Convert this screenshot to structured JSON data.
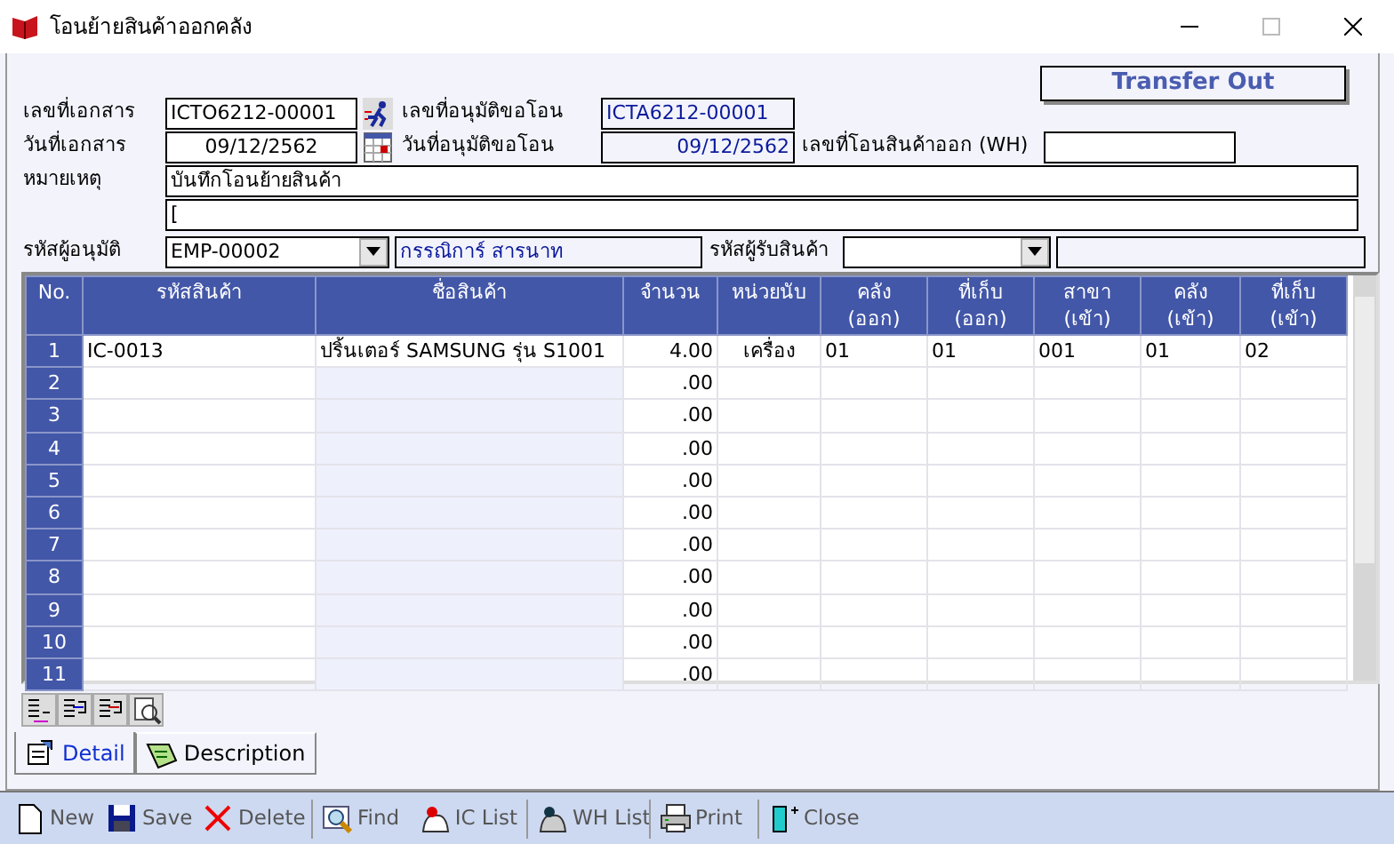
{
  "window": {
    "title": "โอนย้ายสินค้าออกคลัง"
  },
  "mode_badge": "Transfer Out",
  "header": {
    "doc_no": {
      "label": "เลขที่เอกสาร",
      "value": "ICTO6212-00001"
    },
    "approve_no": {
      "label": "เลขที่อนุมัติขอโอน",
      "value": "ICTA6212-00001"
    },
    "doc_date": {
      "label": "วันที่เอกสาร",
      "value": "09/12/2562"
    },
    "approve_date": {
      "label": "วันที่อนุมัติขอโอน",
      "value": "09/12/2562"
    },
    "wh_transfer_no": {
      "label": "เลขที่โอนสินค้าออก (WH)"
    },
    "remark": {
      "label": "หมายเหตุ",
      "value": "บันทึกโอนย้ายสินค้า",
      "value2": "["
    },
    "approver": {
      "label": "รหัสผู้อนุมัติ",
      "value": "EMP-00002",
      "name": "กรรณิการ์ สารนาท"
    },
    "receiver": {
      "label": "รหัสผู้รับสินค้า"
    }
  },
  "table": {
    "columns": [
      {
        "lines": [
          "No."
        ]
      },
      {
        "lines": [
          "รหัสสินค้า"
        ]
      },
      {
        "lines": [
          "ชื่อสินค้า"
        ]
      },
      {
        "lines": [
          "จำนวน"
        ]
      },
      {
        "lines": [
          "หน่วยนับ"
        ]
      },
      {
        "lines": [
          "คลัง",
          "(ออก)"
        ]
      },
      {
        "lines": [
          "ที่เก็บ",
          "(ออก)"
        ]
      },
      {
        "lines": [
          "สาขา",
          "(เข้า)"
        ]
      },
      {
        "lines": [
          "คลัง",
          "(เข้า)"
        ]
      },
      {
        "lines": [
          "ที่เก็บ",
          "(เข้า)"
        ]
      }
    ],
    "rows": [
      {
        "cells": [
          "1",
          "IC-0013",
          "ปริ้นเตอร์ SAMSUNG  รุ่น S1001",
          "4.00",
          "เครื่อง",
          "01",
          "01",
          "001",
          "01",
          "02"
        ]
      },
      {
        "cells": [
          "2",
          "",
          "",
          ".00",
          "",
          "",
          "",
          "",
          "",
          ""
        ]
      },
      {
        "cells": [
          "3",
          "",
          "",
          ".00",
          "",
          "",
          "",
          "",
          "",
          ""
        ]
      },
      {
        "cells": [
          "4",
          "",
          "",
          ".00",
          "",
          "",
          "",
          "",
          "",
          ""
        ]
      },
      {
        "cells": [
          "5",
          "",
          "",
          ".00",
          "",
          "",
          "",
          "",
          "",
          ""
        ]
      },
      {
        "cells": [
          "6",
          "",
          "",
          ".00",
          "",
          "",
          "",
          "",
          "",
          ""
        ]
      },
      {
        "cells": [
          "7",
          "",
          "",
          ".00",
          "",
          "",
          "",
          "",
          "",
          ""
        ]
      },
      {
        "cells": [
          "8",
          "",
          "",
          ".00",
          "",
          "",
          "",
          "",
          "",
          ""
        ]
      },
      {
        "cells": [
          "9",
          "",
          "",
          ".00",
          "",
          "",
          "",
          "",
          "",
          ""
        ]
      },
      {
        "cells": [
          "10",
          "",
          "",
          ".00",
          "",
          "",
          "",
          "",
          "",
          ""
        ]
      },
      {
        "cells": [
          "11",
          "",
          "",
          ".00",
          "",
          "",
          "",
          "",
          "",
          ""
        ]
      }
    ]
  },
  "tabs": [
    {
      "label": "Detail",
      "selected": true
    },
    {
      "label": "Description",
      "selected": false
    }
  ],
  "toolbar": [
    {
      "label": "New",
      "kind": "new"
    },
    {
      "label": "Save",
      "kind": "save"
    },
    {
      "label": "Delete",
      "kind": "delete"
    },
    {
      "kind": "sep"
    },
    {
      "label": "Find",
      "kind": "find"
    },
    {
      "label": "IC List",
      "kind": "iclist"
    },
    {
      "kind": "sep"
    },
    {
      "label": "WH List",
      "kind": "whlist"
    },
    {
      "kind": "sep"
    },
    {
      "label": "Print",
      "kind": "print"
    },
    {
      "kind": "sep"
    },
    {
      "label": "Close",
      "kind": "close"
    }
  ]
}
